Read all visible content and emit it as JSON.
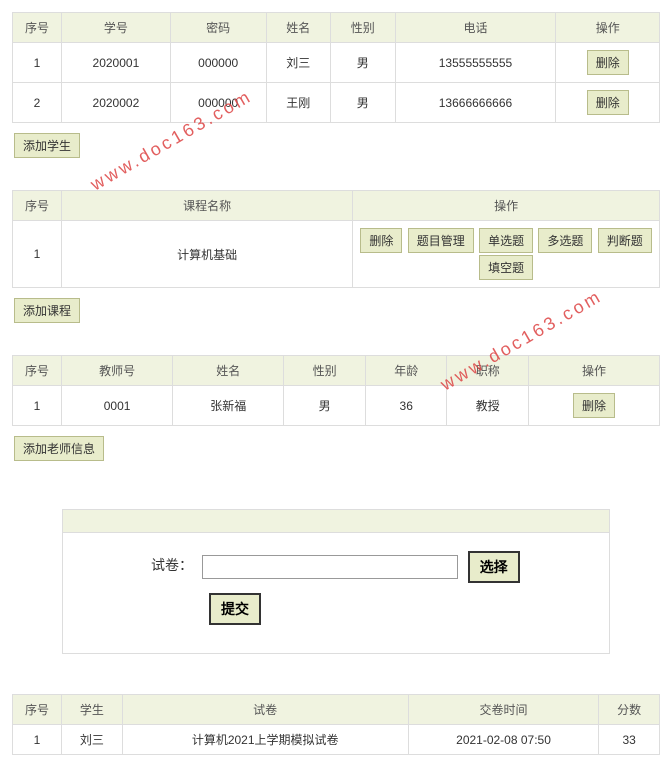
{
  "watermark": "www.doc163.com",
  "students": {
    "headers": {
      "seq": "序号",
      "id": "学号",
      "pwd": "密码",
      "name": "姓名",
      "gender": "性别",
      "phone": "电话",
      "op": "操作"
    },
    "rows": [
      {
        "seq": "1",
        "id": "2020001",
        "pwd": "000000",
        "name": "刘三",
        "gender": "男",
        "phone": "13555555555"
      },
      {
        "seq": "2",
        "id": "2020002",
        "pwd": "000000",
        "name": "王刚",
        "gender": "男",
        "phone": "13666666666"
      }
    ],
    "delete": "删除",
    "add": "添加学生"
  },
  "courses": {
    "headers": {
      "seq": "序号",
      "name": "课程名称",
      "op": "操作"
    },
    "rows": [
      {
        "seq": "1",
        "name": "计算机基础"
      }
    ],
    "ops": {
      "delete": "删除",
      "qmgr": "题目管理",
      "single": "单选题",
      "multi": "多选题",
      "judge": "判断题",
      "fill": "填空题"
    },
    "add": "添加课程"
  },
  "teachers": {
    "headers": {
      "seq": "序号",
      "tid": "教师号",
      "name": "姓名",
      "gender": "性别",
      "age": "年龄",
      "title": "职称",
      "op": "操作"
    },
    "rows": [
      {
        "seq": "1",
        "tid": "0001",
        "name": "张新福",
        "gender": "男",
        "age": "36",
        "title": "教授"
      }
    ],
    "delete": "删除",
    "add": "添加老师信息"
  },
  "form": {
    "label": "试卷：",
    "select": "选择",
    "submit": "提交"
  },
  "results": {
    "headers": {
      "seq": "序号",
      "student": "学生",
      "exam": "试卷",
      "time": "交卷时间",
      "score": "分数"
    },
    "rows": [
      {
        "seq": "1",
        "student": "刘三",
        "exam": "计算机2021上学期模拟试卷",
        "time": "2021-02-08 07:50",
        "score": "33"
      }
    ]
  }
}
